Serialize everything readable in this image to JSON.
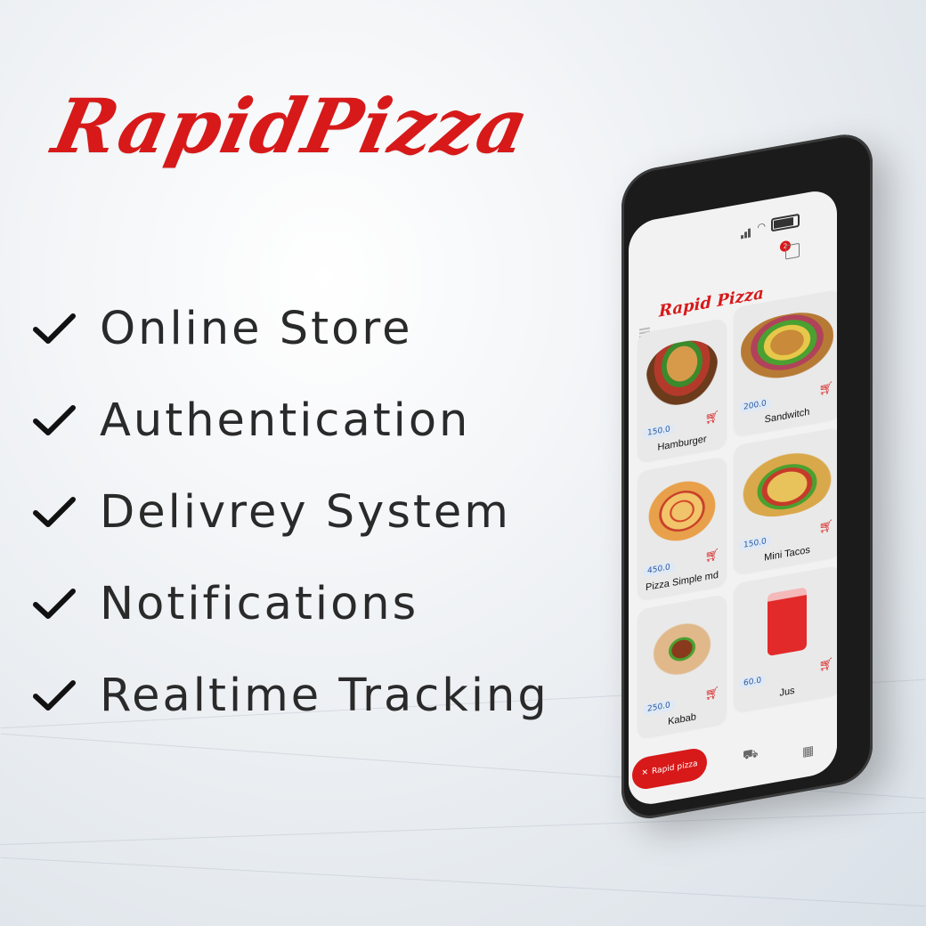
{
  "brand": {
    "title": "RapidPizza",
    "color": "#d71919"
  },
  "features": [
    {
      "label": "Online Store"
    },
    {
      "label": "Authentication"
    },
    {
      "label": "Delivrey System"
    },
    {
      "label": "Notifications"
    },
    {
      "label": "Realtime Tracking"
    }
  ],
  "app": {
    "title": "Rapid Pizza",
    "cart_count": "2",
    "products": [
      {
        "name": "Hamburger",
        "price": "150.0"
      },
      {
        "name": "Sandwitch",
        "price": "200.0"
      },
      {
        "name": "Pizza Simple md",
        "price": "450.0"
      },
      {
        "name": "Mini Tacos",
        "price": "150.0"
      },
      {
        "name": "Kabab",
        "price": "250.0"
      },
      {
        "name": "Jus",
        "price": "60.0"
      }
    ],
    "nav": {
      "active_label": "Rapid pizza"
    }
  }
}
